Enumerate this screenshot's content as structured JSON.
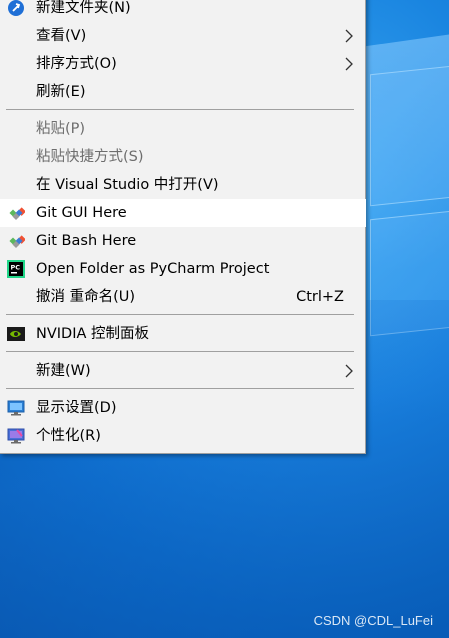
{
  "menu": {
    "items": [
      {
        "label": "新建文件夹(N)",
        "icon": "new-folder-icon",
        "disabled": false
      },
      {
        "label": "查看(V)",
        "submenu": true
      },
      {
        "label": "排序方式(O)",
        "submenu": true
      },
      {
        "label": "刷新(E)"
      },
      {
        "label": "粘贴(P)",
        "disabled": true
      },
      {
        "label": "粘贴快捷方式(S)",
        "disabled": true
      },
      {
        "label": "在 Visual Studio 中打开(V)"
      },
      {
        "label": "Git GUI Here",
        "icon": "git-icon",
        "hovered": true
      },
      {
        "label": "Git Bash Here",
        "icon": "git-icon"
      },
      {
        "label": "Open Folder as PyCharm Project",
        "icon": "pycharm-icon"
      },
      {
        "label": "撤消 重命名(U)",
        "shortcut": "Ctrl+Z"
      },
      {
        "label": "NVIDIA 控制面板",
        "icon": "nvidia-icon"
      },
      {
        "label": "新建(W)",
        "submenu": true
      },
      {
        "label": "显示设置(D)",
        "icon": "display-settings-icon"
      },
      {
        "label": "个性化(R)",
        "icon": "personalize-icon"
      }
    ]
  },
  "desktop": {
    "watermark": "CSDN @CDL_LuFei"
  },
  "colors": {
    "menu_background": "#f2f2f2",
    "hover_background": "#ffffff",
    "disabled_text": "#6d6d6d",
    "desktop_blue": "#0a74cf"
  }
}
